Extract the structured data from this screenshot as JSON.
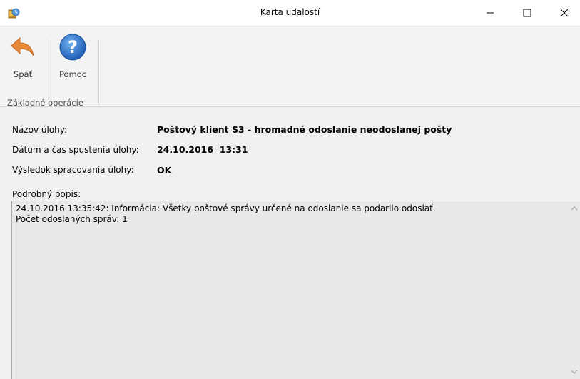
{
  "window": {
    "title": "Karta udalostí"
  },
  "ribbon": {
    "back_label": "Späť",
    "help_label": "Pomoc",
    "group_label": "Základné operácie"
  },
  "task": {
    "name_label": "Názov úlohy:",
    "name_value": "Poštový klient S3 - hromadné odoslanie neodoslanej pošty",
    "datetime_label": "Dátum a čas spustenia úlohy:",
    "datetime_value": "24.10.2016  13:31",
    "result_label": "Výsledok spracovania úlohy:",
    "result_value": "OK"
  },
  "description": {
    "label": "Podrobný popis:",
    "lines": [
      "24.10.2016 13:35:42: Informácia: Všetky poštové správy určené na odoslanie sa podarilo odoslať.",
      "Počet odoslaných správ: 1"
    ]
  },
  "colors": {
    "back_arrow": "#e8893a",
    "help_circle": "#2c74c9"
  },
  "icons": [
    "app-icon",
    "minimize-icon",
    "maximize-icon",
    "close-icon",
    "back-arrow-icon",
    "help-icon",
    "scroll-up-icon",
    "scroll-down-icon"
  ]
}
